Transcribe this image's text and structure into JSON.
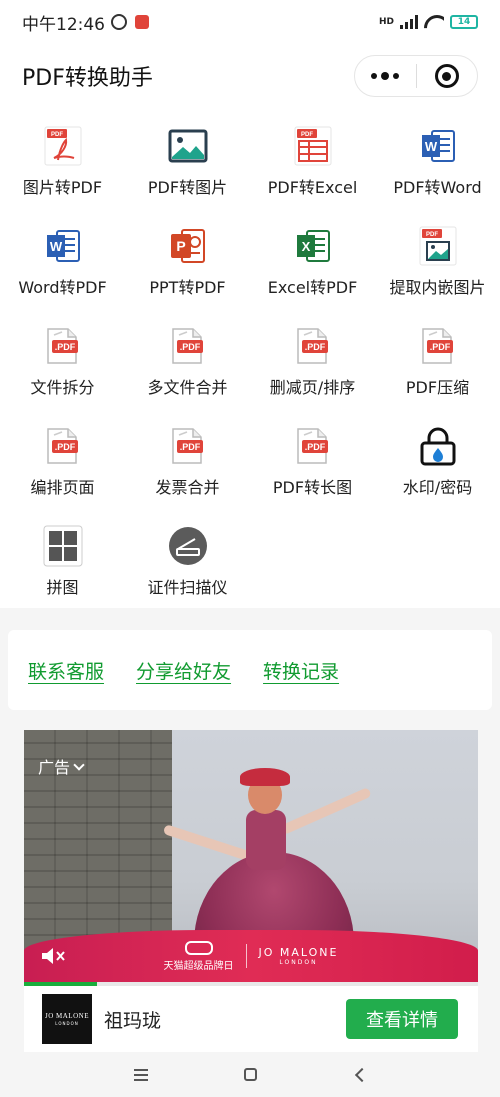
{
  "status_bar": {
    "time": "中午12:46",
    "network_badge": "HD",
    "battery": "14"
  },
  "header": {
    "title": "PDF转换助手"
  },
  "tools": [
    {
      "label": "图片转PDF",
      "icon": "image-to-pdf-icon"
    },
    {
      "label": "PDF转图片",
      "icon": "pdf-to-image-icon"
    },
    {
      "label": "PDF转Excel",
      "icon": "pdf-to-excel-icon"
    },
    {
      "label": "PDF转Word",
      "icon": "pdf-to-word-icon"
    },
    {
      "label": "Word转PDF",
      "icon": "word-to-pdf-icon"
    },
    {
      "label": "PPT转PDF",
      "icon": "ppt-to-pdf-icon"
    },
    {
      "label": "Excel转PDF",
      "icon": "excel-to-pdf-icon"
    },
    {
      "label": "提取内嵌图片",
      "icon": "extract-images-icon"
    },
    {
      "label": "文件拆分",
      "icon": "pdf-doc-icon"
    },
    {
      "label": "多文件合并",
      "icon": "pdf-doc-icon"
    },
    {
      "label": "删减页/排序",
      "icon": "pdf-doc-icon"
    },
    {
      "label": "PDF压缩",
      "icon": "pdf-doc-icon"
    },
    {
      "label": "编排页面",
      "icon": "pdf-doc-icon"
    },
    {
      "label": "发票合并",
      "icon": "pdf-doc-icon"
    },
    {
      "label": "PDF转长图",
      "icon": "pdf-doc-icon"
    },
    {
      "label": "水印/密码",
      "icon": "lock-icon"
    },
    {
      "label": "拼图",
      "icon": "grid-icon"
    },
    {
      "label": "证件扫描仪",
      "icon": "scanner-icon"
    }
  ],
  "links": {
    "contact": "联系客服",
    "share": "分享给好友",
    "history": "转换记录"
  },
  "ad": {
    "label": "广告",
    "banner_text": "天猫超级品牌日",
    "banner_brand": "JO MALONE",
    "banner_brand_sub": "LONDON",
    "brand_logo_text": "JO MALONE",
    "brand_logo_sub": "LONDON",
    "brand_name": "祖玛珑",
    "cta": "查看详情",
    "progress": 0.16
  },
  "colors": {
    "link_green": "#119b30",
    "cta_green": "#22ad4d",
    "pdf_red": "#e0443a",
    "word_blue": "#2b5fb4",
    "excel_green": "#1f7a3d",
    "ppt_orange": "#d24726"
  }
}
